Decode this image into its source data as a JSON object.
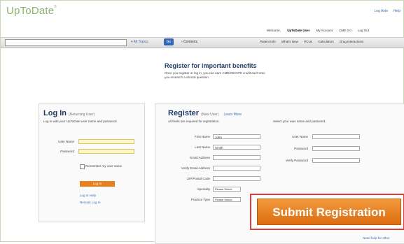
{
  "header": {
    "logo": "UpToDate",
    "logo_mark": "®",
    "top_links": [
      "Log Ante",
      "Help"
    ]
  },
  "userbar": {
    "welcome_label": "Welcome,",
    "welcome_user": "UpToDate User",
    "items": [
      "My Account",
      "CME 0.0",
      "Log Out"
    ]
  },
  "nav": {
    "search_value": "",
    "topics_label": "All Topics",
    "go_label": "Go",
    "contents_label": "Contents",
    "links": [
      "Patient Info",
      "What's New",
      "PCUs",
      "Calculators",
      "Drug Interactions"
    ]
  },
  "hero": {
    "title": "Register for important benefits",
    "text": "Once you register or log in, you can earn CME/CE/CPD credit each time you research a clinical question."
  },
  "login": {
    "title": "Log In",
    "subtitle": "(Returning User)",
    "intro": "Log in with your UpToDate user name and password.",
    "fields": {
      "username_label": "User Name",
      "password_label": "Password"
    },
    "remember_label": "Remember my user name",
    "button_label": "Log In",
    "links": [
      "Log In Help",
      "Remote Log In"
    ]
  },
  "register": {
    "title": "Register",
    "subtitle": "(New User)",
    "learn_more": "Learn More",
    "required_note": "All fields are required for registration.",
    "select_note": "Select your user name and password.",
    "fields": [
      {
        "label": "First Name",
        "value": "John"
      },
      {
        "label": "Last Name",
        "value": "Smith"
      },
      {
        "label": "Email Address",
        "value": ""
      },
      {
        "label": "Verify Email Address",
        "value": ""
      },
      {
        "label": "ZIP/Postal Code",
        "value": ""
      },
      {
        "label": "Specialty",
        "value": "Please Select"
      },
      {
        "label": "Practice Type",
        "value": "Please Select"
      }
    ],
    "account_fields": [
      {
        "label": "User Name",
        "value": ""
      },
      {
        "label": "Password",
        "value": ""
      },
      {
        "label": "Verify Password",
        "value": ""
      }
    ],
    "submit_label": "Submit Registration",
    "bottom_link": "Need help for other"
  },
  "colors": {
    "accent_orange": "#e9801f",
    "highlight_red": "#e23b3b",
    "link_blue": "#3e6fb0",
    "title_navy": "#1f3b66",
    "logo_green": "#8fb26e"
  }
}
